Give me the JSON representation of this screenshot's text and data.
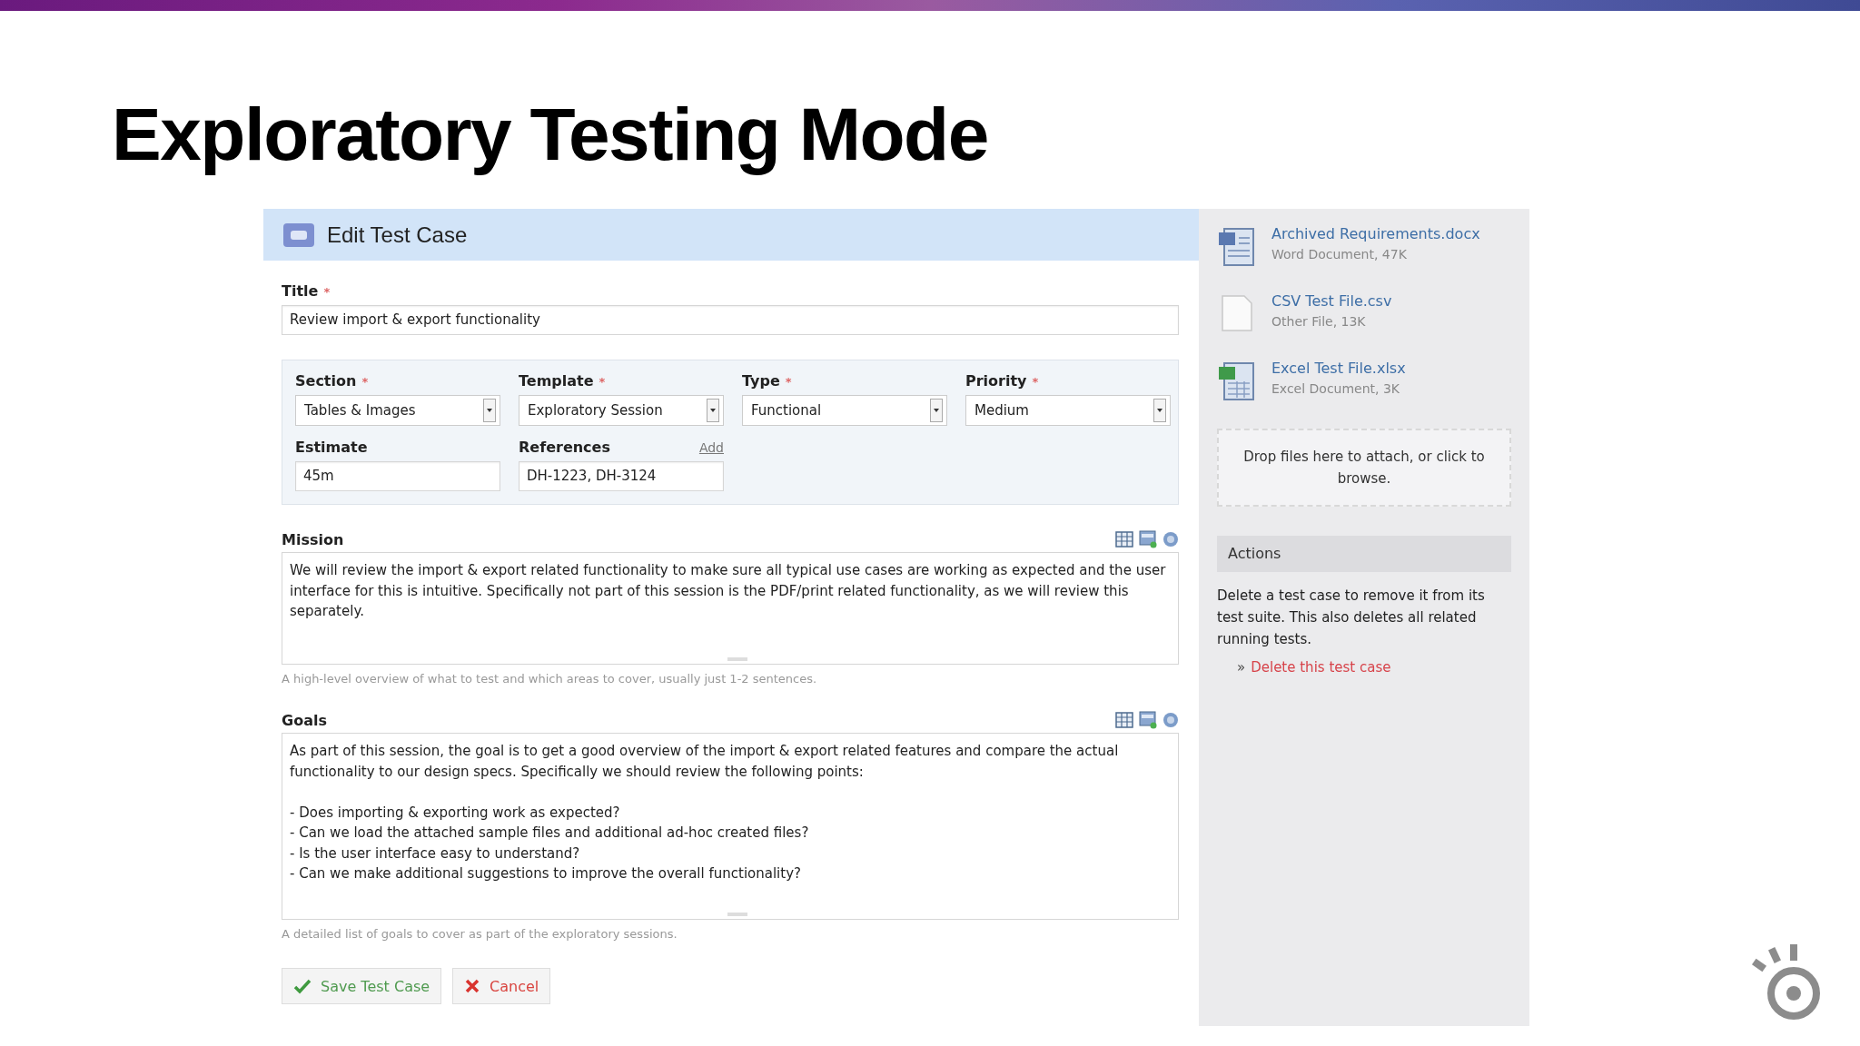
{
  "slide_title": "Exploratory Testing Mode",
  "form": {
    "header_title": "Edit Test Case",
    "title_field": {
      "label": "Title",
      "required_mark": "*",
      "value": "Review import & export functionality"
    },
    "fields": [
      {
        "label": "Section",
        "required_mark": "*",
        "kind": "select",
        "value": "Tables & Images"
      },
      {
        "label": "Template",
        "required_mark": "*",
        "kind": "select",
        "value": "Exploratory Session"
      },
      {
        "label": "Type",
        "required_mark": "*",
        "kind": "select",
        "value": "Functional"
      },
      {
        "label": "Priority",
        "required_mark": "*",
        "kind": "select",
        "value": "Medium"
      },
      {
        "label": "Estimate",
        "kind": "text",
        "value": "45m"
      },
      {
        "label": "References",
        "kind": "text",
        "value": "DH-1223, DH-3124",
        "action": "Add"
      }
    ],
    "text_areas": [
      {
        "label": "Mission",
        "value": "We will review the import & export related functionality to make sure all typical use cases are working as expected and the user interface for this is intuitive. Specifically not part of this session is the PDF/print related functionality, as we will review this separately.",
        "hint": "A high-level overview of what to test and which areas to cover, usually just 1-2 sentences."
      },
      {
        "label": "Goals",
        "value": "As part of this session, the goal is to get a good overview of the import & export related features and compare the actual functionality to our design specs. Specifically we should review the following points:\n\n- Does importing & exporting work as expected?\n- Can we load the attached sample files and additional ad-hoc created files?\n- Is the user interface easy to understand?\n- Can we make additional suggestions to improve the overall functionality?",
        "hint": "A detailed list of goals to cover as part of the exploratory sessions."
      }
    ],
    "buttons": [
      {
        "label": "Save Test Case",
        "kind": "save"
      },
      {
        "label": "Cancel",
        "kind": "cancel"
      }
    ]
  },
  "sidebar": {
    "attachments": [
      {
        "name": "Archived Requirements.docx",
        "meta": "Word Document, 47K",
        "kind": "word"
      },
      {
        "name": "CSV Test File.csv",
        "meta": "Other File, 13K",
        "kind": "other"
      },
      {
        "name": "Excel Test File.xlsx",
        "meta": "Excel Document, 3K",
        "kind": "excel"
      }
    ],
    "drop_zone": "Drop files here to attach, or click to browse.",
    "actions": {
      "header": "Actions",
      "description": "Delete a test case to remove it from its test suite. This also deletes all related running tests.",
      "bullet": "»",
      "link": "Delete this test case"
    }
  }
}
